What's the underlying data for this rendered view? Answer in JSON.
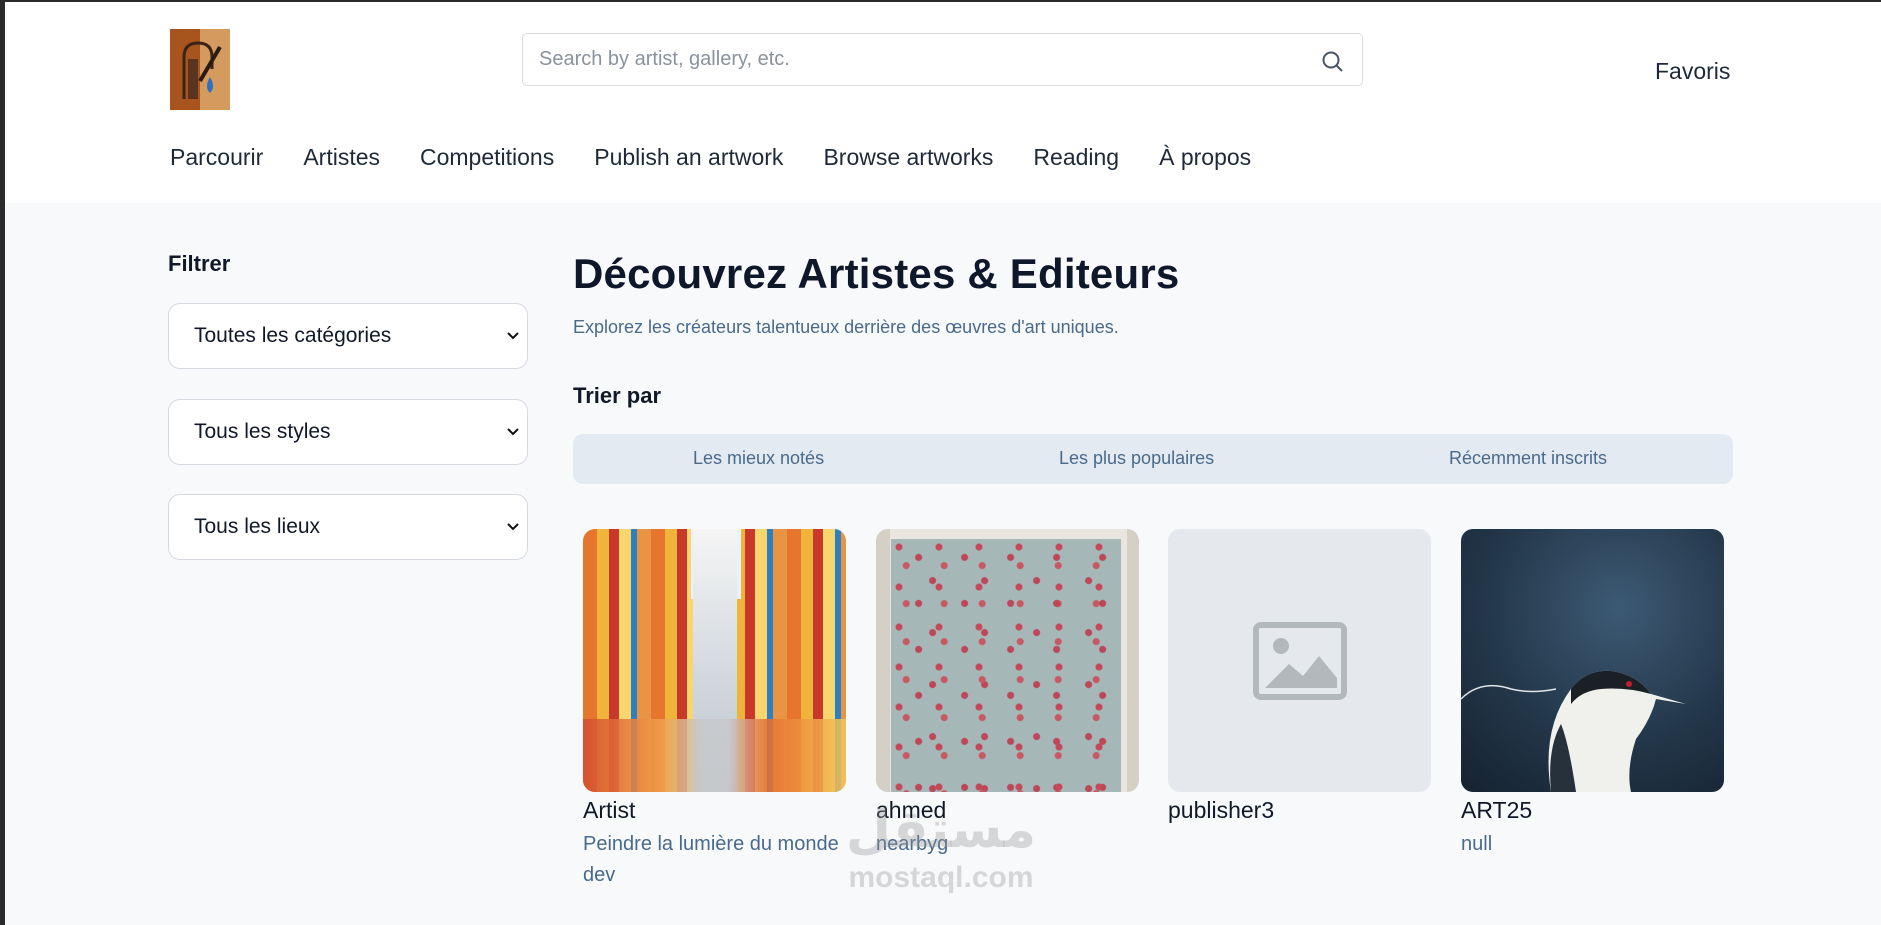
{
  "header": {
    "search_placeholder": "Search by artist, gallery, etc.",
    "favoris": "Favoris",
    "nav": [
      "Parcourir",
      "Artistes",
      "Competitions",
      "Publish an artwork",
      "Browse artworks",
      "Reading",
      "À propos"
    ]
  },
  "sidebar": {
    "title": "Filtrer",
    "selects": [
      "Toutes les catégories",
      "Tous les styles",
      "Tous les lieux"
    ]
  },
  "main": {
    "title": "Découvrez Artistes & Editeurs",
    "subtitle": "Explorez les créateurs talentueux derrière des œuvres d'art uniques.",
    "sort_title": "Trier par",
    "sort_options": [
      "Les mieux notés",
      "Les plus populaires",
      "Récemment inscrits"
    ]
  },
  "cards": [
    {
      "name": "Artist",
      "desc": "Peindre la lumière du monde dev"
    },
    {
      "name": "ahmed",
      "desc": "nearbyg"
    },
    {
      "name": "publisher3",
      "desc": ""
    },
    {
      "name": "ART25",
      "desc": "null"
    }
  ],
  "watermark": {
    "arabic": "مستقل",
    "latin": "mostaql.com"
  },
  "colors": {
    "accent_text": "#4a6a8c",
    "sort_bar_bg": "#e3eaf1",
    "page_bg": "#f7f9fb"
  }
}
